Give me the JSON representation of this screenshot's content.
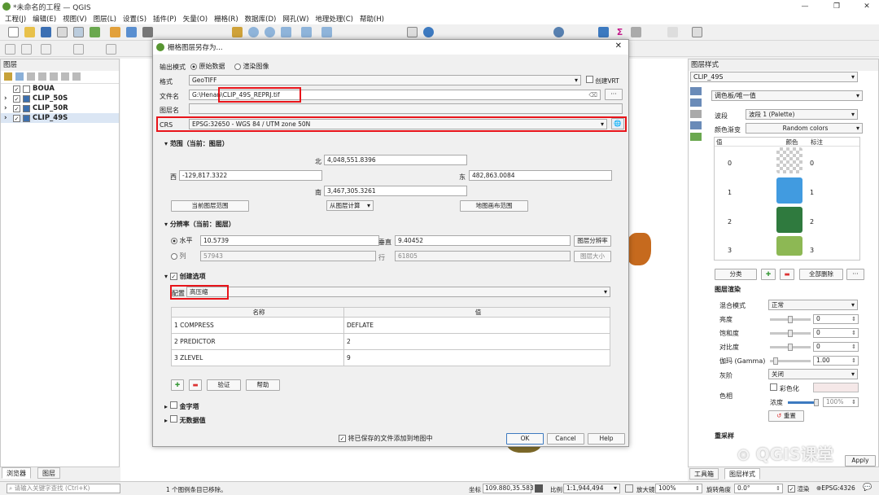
{
  "window": {
    "title": "*未命名的工程 — QGIS",
    "min": "—",
    "max": "❐",
    "close": "✕"
  },
  "menu": [
    "工程(J)",
    "编辑(E)",
    "视图(V)",
    "图层(L)",
    "设置(S)",
    "插件(P)",
    "矢量(O)",
    "栅格(R)",
    "数据库(D)",
    "网孔(W)",
    "地理处理(C)",
    "帮助(H)"
  ],
  "layers_panel": {
    "title": "图层",
    "items": [
      {
        "label": "BOUA",
        "checked": true,
        "bold": true
      },
      {
        "label": "CLIP_50S",
        "checked": true
      },
      {
        "label": "CLIP_50R",
        "checked": true
      },
      {
        "label": "CLIP_49S",
        "checked": true
      }
    ]
  },
  "left_tabs": [
    "浏览器",
    "图层"
  ],
  "dialog": {
    "title": "栅格图层另存为...",
    "output_mode_label": "输出模式",
    "raw_data": "原始数据",
    "rendered": "渲染图像",
    "format_label": "格式",
    "format_value": "GeoTIFF",
    "create_vrt": "创建VRT",
    "filename_label": "文件名",
    "filename_prefix": "G:\\Henan\\",
    "filename_value": "CLIP_49S_REPRJ.tif",
    "browse": "···",
    "layername_label": "图层名",
    "crs_label": "CRS",
    "crs_value": "EPSG:32650 - WGS 84 / UTM zone 50N",
    "extent_title": "范围（当前：图层）",
    "north_label": "北",
    "north": "4,048,551.8396",
    "west_label": "西",
    "west": "-129,817.3322",
    "east_label": "东",
    "east": "482,863.0084",
    "south_label": "南",
    "south": "3,467,305.3261",
    "current_layer_extent": "当前图层范围",
    "calc_from_layer": "从图层计算",
    "map_canvas_extent": "地图画布范围",
    "resolution_title": "分辨率（当前：图层）",
    "horizontal_label": "水平",
    "horizontal": "10.5739",
    "vertical_label": "垂直",
    "vertical": "9.40452",
    "layer_resolution": "图层分辨率",
    "cols_label": "列",
    "cols": "57943",
    "rows_label": "行",
    "rows": "61805",
    "layer_size": "图层大小",
    "create_options_title": "创建选项",
    "profile_label": "配置",
    "profile_value": "高压缩",
    "table_headers": [
      "名称",
      "值"
    ],
    "options": [
      {
        "n": "1",
        "name": "COMPRESS",
        "value": "DEFLATE"
      },
      {
        "n": "2",
        "name": "PREDICTOR",
        "value": "2"
      },
      {
        "n": "3",
        "name": "ZLEVEL",
        "value": "9"
      }
    ],
    "validate": "验证",
    "help_small": "帮助",
    "pyramids": "金字塔",
    "nodata": "无数据值",
    "add_to_map": "将已保存的文件添加到地图中",
    "ok": "OK",
    "cancel": "Cancel",
    "help": "Help"
  },
  "style_panel": {
    "title": "图层样式",
    "layer": "CLIP_49S",
    "renderer": "调色板/唯一值",
    "band_label": "波段",
    "band_value": "波段 1 (Palette)",
    "ramp_label": "颜色渐变",
    "ramp_value": "Random colors",
    "col_value": "值",
    "col_color": "颜色",
    "col_label": "标注",
    "entries": [
      {
        "v": "0",
        "color": "transparent",
        "l": "0"
      },
      {
        "v": "1",
        "color": "#419be0",
        "l": "1"
      },
      {
        "v": "2",
        "color": "#2f7a3e",
        "l": "2"
      },
      {
        "v": "3",
        "color": "#8db854",
        "l": "3"
      }
    ],
    "classify": "分类",
    "delete_all": "全部删除",
    "more": "···",
    "render_title": "图层渲染",
    "blend_label": "混合模式",
    "blend_value": "正常",
    "brightness_label": "亮度",
    "brightness": "0",
    "saturation_label": "饱和度",
    "saturation": "0",
    "contrast_label": "对比度",
    "contrast": "0",
    "gamma_label": "伽玛 (Gamma)",
    "gamma": "1.00",
    "gray_label": "灰阶",
    "gray_value": "关闭",
    "hue_label": "色相",
    "colorize": "彩色化",
    "strength_label": "浓度",
    "strength": "100%",
    "reset": "重置",
    "resample_label": "重采样",
    "apply": "Apply",
    "tabs": [
      "工具箱",
      "图层样式"
    ]
  },
  "statusbar": {
    "search_placeholder": "请输入关键字查找 (Ctrl+K)",
    "message": "1 个图例条目已移除。",
    "coord_label": "坐标",
    "coord": "109.880,35.583",
    "scale_label": "比例",
    "scale": "1:1,944,494",
    "magnifier_label": "放大镜",
    "magnifier": "100%",
    "rotation_label": "旋转角度",
    "rotation": "0.0°",
    "render": "渲染",
    "epsg": "EPSG:4326"
  },
  "watermark": "QGIS课堂"
}
